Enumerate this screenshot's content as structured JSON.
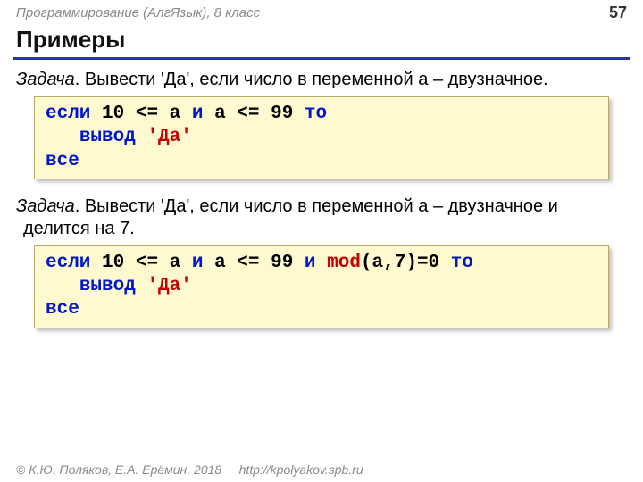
{
  "header": {
    "course": "Программирование (АлгЯзык), 8 класс",
    "page": "57"
  },
  "title": "Примеры",
  "task1": {
    "label": "Задача",
    "text": ". Вывести 'Да', если число в переменной a – двузначное."
  },
  "code1": {
    "kw_if": "если",
    "n10": " 10 ",
    "op1": "<= a ",
    "kw_and": "и",
    "mid": " a ",
    "op2": "<= 99 ",
    "kw_then": "то",
    "indent": "   ",
    "kw_out": "вывод",
    "sp": " ",
    "str": "'Да'",
    "kw_end": "все"
  },
  "task2": {
    "label": "Задача",
    "text": ". Вывести 'Да', если число в переменной a – двузначное и делится на 7."
  },
  "code2": {
    "kw_if": "если",
    "n10": " 10 ",
    "op1": "<= a ",
    "kw_and1": "и",
    "mid": " a ",
    "op2": "<= 99 ",
    "kw_and2": "и",
    "sp1": " ",
    "fn": "mod",
    "args": "(a,7)=0 ",
    "kw_then": "то",
    "indent": "   ",
    "kw_out": "вывод",
    "sp2": " ",
    "str": "'Да'",
    "kw_end": "все"
  },
  "footer": {
    "copy": "© К.Ю. Поляков, Е.А. Ерёмин, 2018",
    "url": "http://kpolyakov.spb.ru"
  }
}
